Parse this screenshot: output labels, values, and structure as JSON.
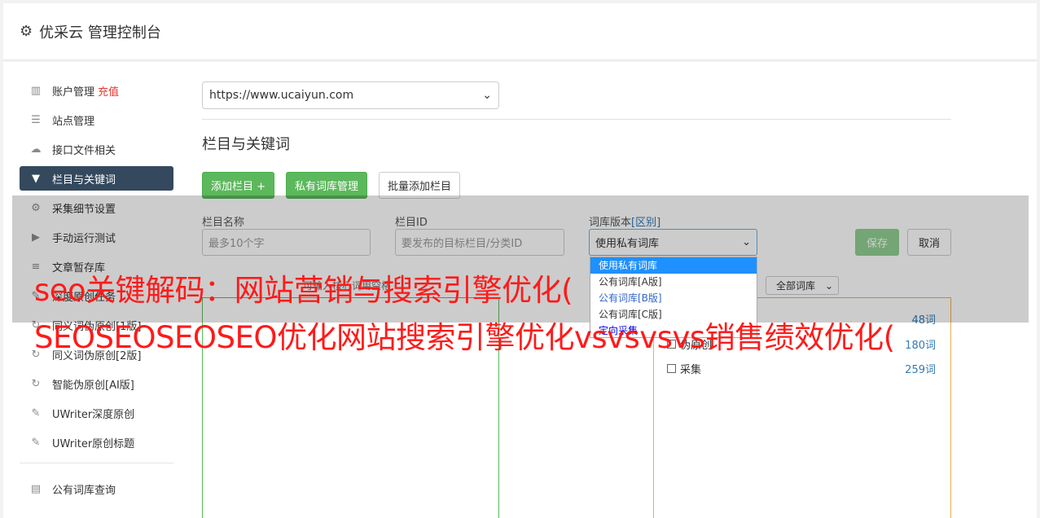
{
  "header": {
    "title": "优采云 管理控制台",
    "icon": "gear-icon"
  },
  "sidebar": {
    "items": [
      {
        "label": "账户管理",
        "extra": "充值",
        "icon": "bar-chart-icon"
      },
      {
        "label": "站点管理",
        "icon": "server-icon"
      },
      {
        "label": "接口文件相关",
        "icon": "cloud-upload-icon"
      },
      {
        "label": "栏目与关键词",
        "icon": "filter-icon",
        "active": true
      },
      {
        "label": "采集细节设置",
        "icon": "cogs-icon"
      },
      {
        "label": "手动运行测试",
        "icon": "play-circle-icon"
      },
      {
        "label": "文章暂存库",
        "icon": "database-icon"
      },
      {
        "label": "深度原创任务",
        "icon": "edit-icon"
      },
      {
        "label": "同义词伪原创[1版]",
        "icon": "refresh-icon"
      },
      {
        "label": "同义词伪原创[2版]",
        "icon": "refresh-icon"
      },
      {
        "label": "智能伪原创[AI版]",
        "icon": "refresh-icon"
      },
      {
        "label": "UWriter深度原创",
        "icon": "edit-icon"
      },
      {
        "label": "UWriter原创标题",
        "icon": "edit-icon"
      }
    ],
    "bottom_items": [
      {
        "label": "公有词库查询",
        "icon": "book-icon"
      }
    ]
  },
  "content": {
    "site_select": "https://www.ucaiyun.com",
    "section_title": "栏目与关键词",
    "buttons": {
      "add_column": "添加栏目 +",
      "private_lib": "私有词库管理",
      "batch_add": "批量添加栏目"
    }
  },
  "form": {
    "name_label": "栏目名称",
    "name_placeholder": "最多10个字",
    "id_label": "栏目ID",
    "id_placeholder": "要发布的目标栏目/分类ID",
    "lib_label": "词库版本",
    "lib_label_link": "[区别]",
    "lib_value": "使用私有词库",
    "lib_options": [
      "使用私有词库",
      "公有词库[A版]",
      "公有词库[B版]",
      "公有词库[C版]",
      "定向采集"
    ],
    "save": "保存",
    "cancel": "取消",
    "hint": "可输入核心词用空格",
    "lib_filter": "全部词库"
  },
  "lib_panel": {
    "rows": [
      {
        "label": "",
        "count": "48词"
      },
      {
        "label": "伪原创",
        "count": "180词"
      },
      {
        "label": "采集",
        "count": "259词"
      }
    ]
  },
  "watermark": {
    "line1": "seo关键解码：网站营销与搜索引擎优化(",
    "line2": "SEOSEOSEOSEO优化网站搜索引擎优化vsvsvsvs销售绩效优化("
  }
}
